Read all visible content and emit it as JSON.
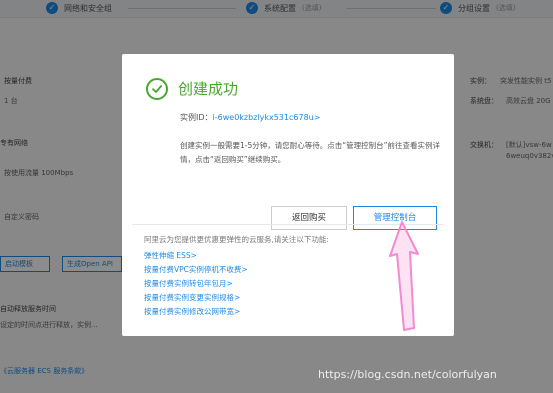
{
  "steps": [
    {
      "num": "✓",
      "label": "网络和安全组",
      "hint": ""
    },
    {
      "num": "✓",
      "label": "系统配置",
      "hint": "(选填)"
    },
    {
      "num": "✓",
      "label": "分组设置",
      "hint": "(选填)"
    }
  ],
  "background": {
    "billing_label": "按量付费",
    "qty": "1 台",
    "network_label": "专有网络",
    "bandwidth": "按使用流量 100Mbps",
    "password": "自定义密码",
    "template_btn": "启动模板",
    "openapi_btn": "生成Open API",
    "auto_release_label": "自动释放服务时间",
    "auto_release_desc": "设定的时间点进行释放，实例...",
    "terms": "《云服务器 ECS 服务条款》",
    "right_instance_label": "实例：",
    "right_instance_value": "突发性能实例 t5",
    "right_disk_label": "系统盘：",
    "right_disk_value": "高效云盘 20G",
    "right_switch_label": "交换机：",
    "right_switch_value": "[默认]vsw-6w",
    "right_switch_value2": "6weuq0v382v"
  },
  "modal": {
    "title": "创建成功",
    "instance_label": "实例ID：",
    "instance_id": "i-6we0kzbzlykx531c678u>",
    "description": "创建实例一般需要1-5分钟，请您耐心等待。点击“管理控制台”前往查看实例详情，点击“返回购买”继续购买。",
    "back_button": "返回购买",
    "console_button": "管理控制台",
    "elastic_intro": "阿里云为您提供更优惠更弹性的云服务,请关注以下功能:",
    "links": [
      "弹性伸缩 ESS>",
      "按量付费VPC实例停机不收费>",
      "按量付费实例转包年包月>",
      "按量付费实例变更实例规格>",
      "按量付费实例修改公网带宽>"
    ]
  },
  "watermark": "https://blog.csdn.net/colorfulyan",
  "colors": {
    "success": "#4aa72e",
    "link": "#1e8ae7",
    "arrow": "#f28bd0"
  }
}
